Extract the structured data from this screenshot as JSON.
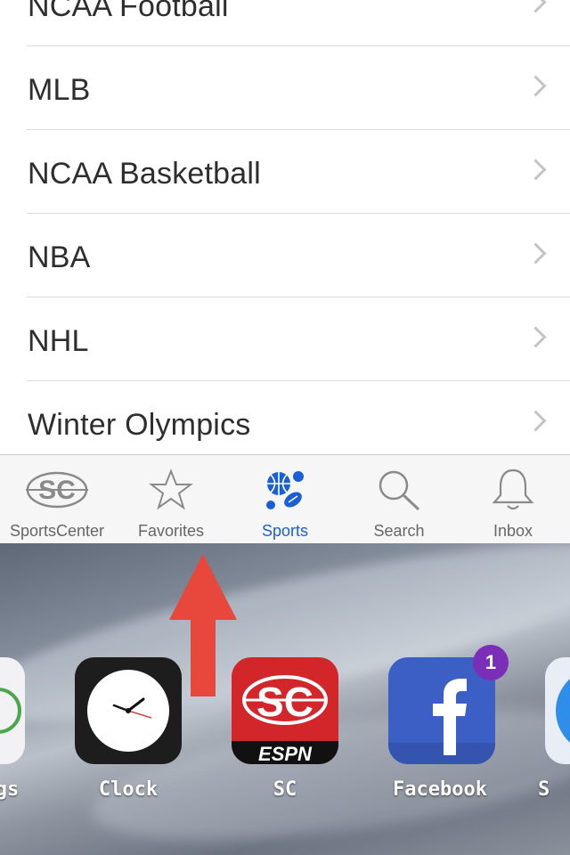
{
  "sports_list": [
    {
      "label": "NCAA Football"
    },
    {
      "label": "MLB"
    },
    {
      "label": "NCAA Basketball"
    },
    {
      "label": "NBA"
    },
    {
      "label": "NHL"
    },
    {
      "label": "Winter Olympics"
    }
  ],
  "tabs": [
    {
      "label": "SportsCenter",
      "icon": "sportscenter-logo-icon"
    },
    {
      "label": "Favorites",
      "icon": "star-icon"
    },
    {
      "label": "Sports",
      "icon": "sports-balls-icon",
      "active": true
    },
    {
      "label": "Search",
      "icon": "search-icon"
    },
    {
      "label": "Inbox",
      "icon": "bell-icon"
    }
  ],
  "home_apps": [
    {
      "label": "gs",
      "icon": "settings-app-icon"
    },
    {
      "label": "Clock",
      "icon": "clock-app-icon"
    },
    {
      "label": "SC",
      "icon": "sportscenter-app-icon",
      "logo_text": "SC",
      "sub_text": "ESPN"
    },
    {
      "label": "Facebook",
      "icon": "facebook-app-icon",
      "badge": "1"
    },
    {
      "label": "S",
      "icon": "safari-app-icon"
    }
  ],
  "colors": {
    "active_tab": "#1a5fd6",
    "arrow": "#e8473b",
    "badge": "#7b2fb8",
    "sc_red": "#d3262b",
    "facebook_blue": "#3b5fc4"
  }
}
